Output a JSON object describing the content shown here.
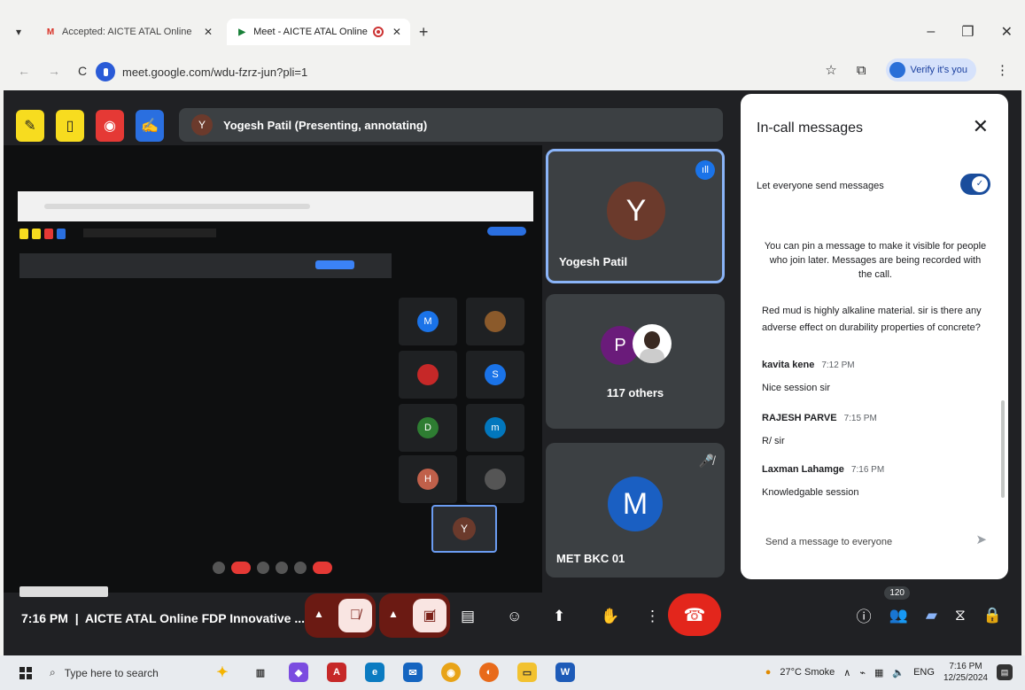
{
  "browser": {
    "tabs": [
      {
        "label": "Accepted: AICTE ATAL Online F",
        "icon": "gmail-icon",
        "active": false
      },
      {
        "label": "Meet - AICTE ATAL Online",
        "icon": "meet-icon",
        "active": true
      }
    ],
    "url": "meet.google.com/wdu-fzrz-jun?pli=1",
    "profile_label": "Verify it's you"
  },
  "meet": {
    "presenter_initial": "Y",
    "presenter_label": "Yogesh Patil (Presenting, annotating)",
    "tiles": [
      {
        "name": "Yogesh Patil",
        "initial": "Y",
        "color": "#6b3a2c"
      },
      {
        "initial": "P",
        "label": "117 others",
        "color": "#6a1b7a"
      },
      {
        "name": "MET BKC 01",
        "initial": "M",
        "color": "#1a5fc2"
      }
    ],
    "nested_tiles": [
      {
        "initial": "M",
        "color": "#1a73e8"
      },
      {
        "initial": "",
        "color": "#8b5a2b"
      },
      {
        "initial": "",
        "color": "#c62828"
      },
      {
        "initial": "S",
        "color": "#1a73e8"
      },
      {
        "initial": "D",
        "color": "#2e7d32"
      },
      {
        "initial": "m",
        "color": "#0277bd"
      },
      {
        "initial": "H",
        "color": "#c0604a"
      },
      {
        "initial": "",
        "color": "#555"
      }
    ],
    "nested_self_initial": "Y",
    "chat": {
      "title": "In-call messages",
      "toggle_label": "Let everyone send messages",
      "toggle_on": true,
      "info": "You can pin a message to make it visible for people who join later. Messages are being recorded with the call.",
      "first_message": "Red mud is highly alkaline material. sir is there any adverse effect on durability properties of concrete?",
      "messages": [
        {
          "sender": "kavita kene",
          "time": "7:12 PM",
          "text": "Nice session sir"
        },
        {
          "sender": "RAJESH PARVE",
          "time": "7:15 PM",
          "text": "R/ sir"
        },
        {
          "sender": "Laxman Lahamge",
          "time": "7:16 PM",
          "text": "Knowledgable session"
        }
      ],
      "send_placeholder": "Send a message to everyone"
    },
    "bottom": {
      "time": "7:16 PM",
      "meeting_title": "AICTE ATAL Online FDP Innovative ...",
      "participant_count": "120"
    }
  },
  "taskbar": {
    "search_placeholder": "Type here to search",
    "weather": "27°C  Smoke",
    "lang": "ENG",
    "time": "7:16 PM",
    "date": "12/25/2024"
  }
}
